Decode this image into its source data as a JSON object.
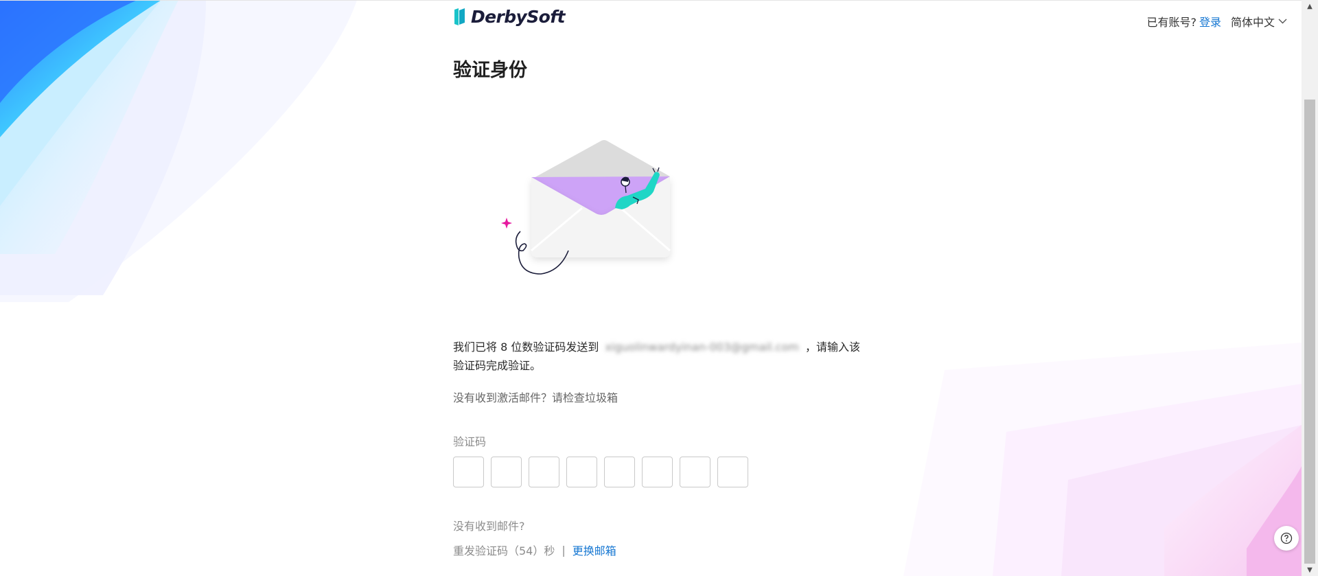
{
  "header": {
    "logo_text": "DerbySoft",
    "account_prompt": "已有账号?",
    "login_label": "登录",
    "language_label": "简体中文"
  },
  "main": {
    "title": "验证身份",
    "description_prefix": "我们已将 8 位数验证码发送到",
    "email_masked": "xiguolinwardyinan-003@gmail.com",
    "description_suffix": "，请输入该验证码完成验证。",
    "spam_hint": "没有收到激活邮件？请检查垃圾箱",
    "code_label": "验证码",
    "code_length": 8,
    "no_mail_label": "没有收到邮件?",
    "resend_label": "重发验证码（54）秒",
    "divider": "|",
    "change_email_label": "更换邮箱"
  },
  "colors": {
    "accent": "#1677d2",
    "logo_teal": "#19c3c9",
    "envelope_purple": "#cda3f7",
    "figure_teal": "#1fd6c6",
    "sparkle_magenta": "#e6199f"
  },
  "icons": {
    "help": "help-circle-icon",
    "language_dropdown": "chevron-down-icon"
  }
}
